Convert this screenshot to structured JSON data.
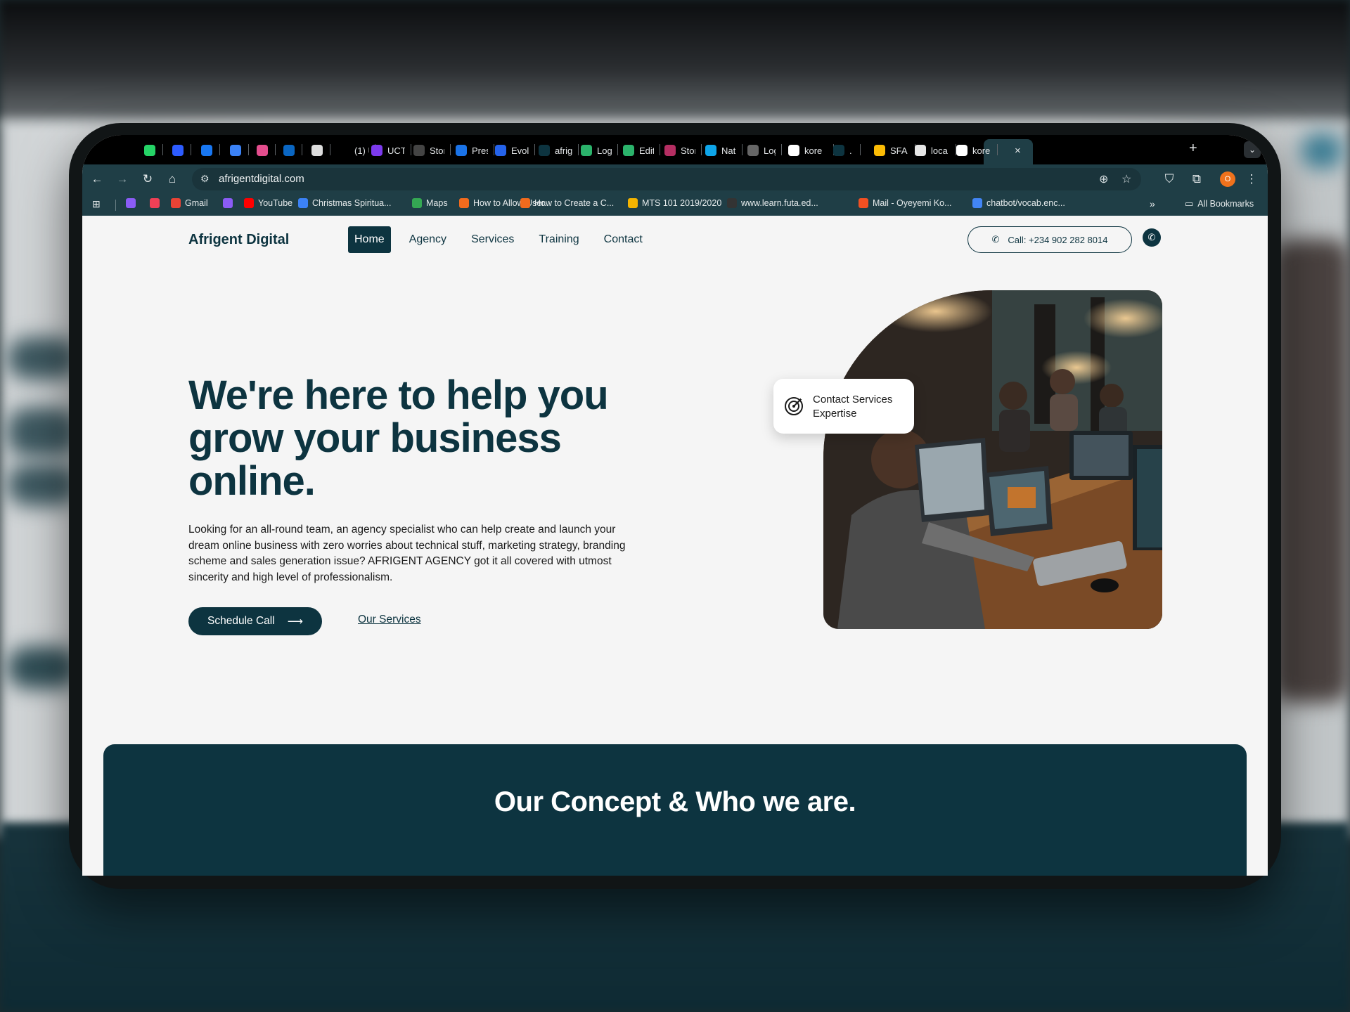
{
  "browser": {
    "tabs": [
      {
        "label": "",
        "icon": "whatsapp-icon",
        "color": "#25d366"
      },
      {
        "label": "",
        "icon": "hashnode-icon",
        "color": "#2d5cff"
      },
      {
        "label": "",
        "icon": "facebook-icon",
        "color": "#1877f2"
      },
      {
        "label": "",
        "icon": "app-icon",
        "color": "#3b82f6"
      },
      {
        "label": "",
        "icon": "clickup-icon",
        "color": "#e44d8d"
      },
      {
        "label": "",
        "icon": "linkedin-icon",
        "color": "#0a66c2"
      },
      {
        "label": "",
        "icon": "smiley-icon",
        "color": "#dddddd"
      },
      {
        "label": "(1) U",
        "icon": "x-icon",
        "color": "#000000"
      },
      {
        "label": "UCT",
        "icon": "uct-icon",
        "color": "#7c3aed"
      },
      {
        "label": "Stor",
        "icon": "storybook-icon",
        "color": "#444444"
      },
      {
        "label": "Pres",
        "icon": "canva-icon",
        "color": "#1a73e8"
      },
      {
        "label": "Evol",
        "icon": "arrow-icon",
        "color": "#2563eb"
      },
      {
        "label": "afrig",
        "icon": "afrigent-icon",
        "color": "#0d3440"
      },
      {
        "label": "Log",
        "icon": "plant-icon",
        "color": "#2bb36b"
      },
      {
        "label": "Edit",
        "icon": "plant-icon",
        "color": "#2bb36b"
      },
      {
        "label": "Stor",
        "icon": "storybook-icon",
        "color": "#b52e62"
      },
      {
        "label": "Natu",
        "icon": "natural-icon",
        "color": "#0ea5e9"
      },
      {
        "label": "Log",
        "icon": "doc-icon",
        "color": "#666666"
      },
      {
        "label": "kore",
        "icon": "github-icon",
        "color": "#ffffff"
      },
      {
        "label": ".",
        "icon": "afrigent-icon",
        "color": "#0d3440"
      },
      {
        "label": "SFA",
        "icon": "drive-icon",
        "color": "#fbbc05"
      },
      {
        "label": "loca",
        "icon": "page-icon",
        "color": "#e6e6e6"
      },
      {
        "label": "kore",
        "icon": "github-icon",
        "color": "#ffffff"
      }
    ],
    "new_tab": "+",
    "url": "afrigentdigital.com",
    "profile_initial": "O",
    "bookmarks": [
      {
        "label": "",
        "icon": "stripe-icon",
        "color": "#8b5cf6"
      },
      {
        "label": "",
        "icon": "pocket-icon",
        "color": "#ef4056"
      },
      {
        "label": "Gmail",
        "icon": "gmail-icon",
        "color": "#ea4335"
      },
      {
        "label": "",
        "icon": "stripe-icon",
        "color": "#8b5cf6"
      },
      {
        "label": "YouTube",
        "icon": "youtube-icon",
        "color": "#ff0000"
      },
      {
        "label": "Christmas Spiritua...",
        "icon": "doc-icon",
        "color": "#3b82f6"
      },
      {
        "label": "Maps",
        "icon": "maps-icon",
        "color": "#34a853"
      },
      {
        "label": "How to Allow User...",
        "icon": "ghost-icon",
        "color": "#f26b1d"
      },
      {
        "label": "How to Create a C...",
        "icon": "ghost-icon",
        "color": "#f26b1d"
      },
      {
        "label": "MTS 101 2019/2020",
        "icon": "slides-icon",
        "color": "#f4b400"
      },
      {
        "label": "www.learn.futa.ed...",
        "icon": "moodle-icon",
        "color": "#333333"
      },
      {
        "label": "Mail - Oyeyemi Ko...",
        "icon": "microsoft-icon",
        "color": "#f25022"
      },
      {
        "label": "chatbot/vocab.enc...",
        "icon": "google-icon",
        "color": "#4285f4"
      }
    ],
    "all_bookmarks": "All Bookmarks"
  },
  "site": {
    "logo": "Afrigent Digital",
    "nav": [
      "Home",
      "Agency",
      "Services",
      "Training",
      "Contact"
    ],
    "call_label": "Call: +234 902 282 8014",
    "hero": {
      "title": "We're here to help you grow your business online.",
      "description": "Looking for an all-round team, an agency specialist who can help create and launch your dream online business with zero worries about technical stuff, marketing strategy, branding scheme and sales generation issue? AFRIGENT AGENCY got it all covered with utmost sincerity and high level of professionalism.",
      "primary_button": "Schedule Call",
      "secondary_link": "Our Services",
      "card_text": "Contact Services Expertise"
    },
    "concept_title": "Our Concept & Who we are."
  },
  "colors": {
    "brand": "#0d3440",
    "chrome": "#1f3e46",
    "background": "#f5f5f5"
  }
}
